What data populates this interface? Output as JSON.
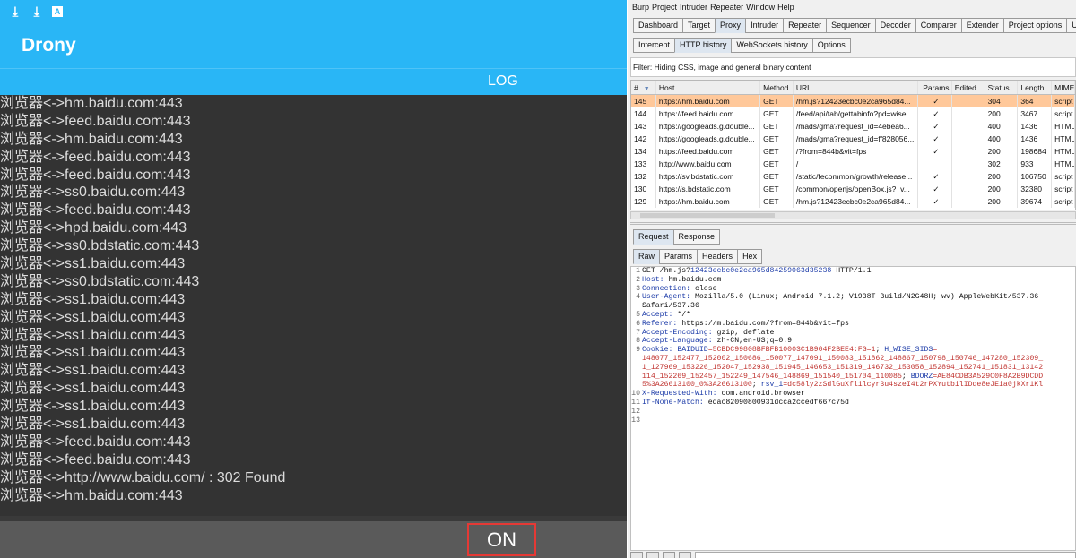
{
  "drony": {
    "app_title": "Drony",
    "tab_label": "LOG",
    "on_button": "ON",
    "statusbar_icons": [
      "download-icon",
      "download-icon",
      "a-box-icon"
    ],
    "log_lines": [
      "浏览器<->hm.baidu.com:443",
      "浏览器<->feed.baidu.com:443",
      "浏览器<->hm.baidu.com:443",
      "浏览器<->feed.baidu.com:443",
      "浏览器<->feed.baidu.com:443",
      "浏览器<->ss0.baidu.com:443",
      "浏览器<->feed.baidu.com:443",
      "浏览器<->hpd.baidu.com:443",
      "浏览器<->ss0.bdstatic.com:443",
      "浏览器<->ss1.baidu.com:443",
      "浏览器<->ss0.bdstatic.com:443",
      "浏览器<->ss1.baidu.com:443",
      "浏览器<->ss1.baidu.com:443",
      "浏览器<->ss1.baidu.com:443",
      "浏览器<->ss1.baidu.com:443",
      "浏览器<->ss1.baidu.com:443",
      "浏览器<->ss1.baidu.com:443",
      "浏览器<->ss1.baidu.com:443",
      "浏览器<->ss1.baidu.com:443",
      "浏览器<->feed.baidu.com:443",
      "浏览器<->feed.baidu.com:443",
      "浏览器<->http://www.baidu.com/ : 302 Found",
      "浏览器<->hm.baidu.com:443"
    ],
    "colors": {
      "accent": "#29b6f6",
      "log_bg": "#333333",
      "on_border": "#e53935"
    }
  },
  "burp": {
    "menu": [
      "Burp",
      "Project",
      "Intruder",
      "Repeater",
      "Window",
      "Help"
    ],
    "main_tabs": [
      "Dashboard",
      "Target",
      "Proxy",
      "Intruder",
      "Repeater",
      "Sequencer",
      "Decoder",
      "Comparer",
      "Extender",
      "Project options",
      "User"
    ],
    "main_tab_active": "Proxy",
    "proxy_tabs": [
      "Intercept",
      "HTTP history",
      "WebSockets history",
      "Options"
    ],
    "proxy_tab_active": "HTTP history",
    "filter_text": "Filter: Hiding CSS, image and general binary content",
    "columns": [
      "#",
      "Host",
      "Method",
      "URL",
      "Params",
      "Edited",
      "Status",
      "Length",
      "MIME"
    ],
    "sort_indicator": "▼",
    "rows": [
      {
        "num": "145",
        "host": "https://hm.baidu.com",
        "method": "GET",
        "url": "/hm.js?12423ecbc0e2ca965d84...",
        "params": "✓",
        "edited": "",
        "status": "304",
        "length": "364",
        "mime": "script",
        "selected": true
      },
      {
        "num": "144",
        "host": "https://feed.baidu.com",
        "method": "GET",
        "url": "/feed/api/tab/gettabinfo?pd=wise...",
        "params": "✓",
        "edited": "",
        "status": "200",
        "length": "3467",
        "mime": "script"
      },
      {
        "num": "143",
        "host": "https://googleads.g.double...",
        "method": "GET",
        "url": "/mads/gma?request_id=4ebea6...",
        "params": "✓",
        "edited": "",
        "status": "400",
        "length": "1436",
        "mime": "HTML"
      },
      {
        "num": "142",
        "host": "https://googleads.g.double...",
        "method": "GET",
        "url": "/mads/gma?request_id=ff828056...",
        "params": "✓",
        "edited": "",
        "status": "400",
        "length": "1436",
        "mime": "HTML"
      },
      {
        "num": "134",
        "host": "https://feed.baidu.com",
        "method": "GET",
        "url": "/?from=844b&vit=fps",
        "params": "✓",
        "edited": "",
        "status": "200",
        "length": "198684",
        "mime": "HTML"
      },
      {
        "num": "133",
        "host": "http://www.baidu.com",
        "method": "GET",
        "url": "/",
        "params": "",
        "edited": "",
        "status": "302",
        "length": "933",
        "mime": "HTML"
      },
      {
        "num": "132",
        "host": "https://sv.bdstatic.com",
        "method": "GET",
        "url": "/static/fecommon/growth/release...",
        "params": "✓",
        "edited": "",
        "status": "200",
        "length": "106750",
        "mime": "script"
      },
      {
        "num": "130",
        "host": "https://s.bdstatic.com",
        "method": "GET",
        "url": "/common/openjs/openBox.js?_v...",
        "params": "✓",
        "edited": "",
        "status": "200",
        "length": "32380",
        "mime": "script"
      },
      {
        "num": "129",
        "host": "https://hm.baidu.com",
        "method": "GET",
        "url": "/hm.js?12423ecbc0e2ca965d84...",
        "params": "✓",
        "edited": "",
        "status": "200",
        "length": "39674",
        "mime": "script"
      }
    ],
    "req_tabs": [
      "Request",
      "Response"
    ],
    "req_tab_active": "Request",
    "raw_tabs": [
      "Raw",
      "Params",
      "Headers",
      "Hex"
    ],
    "raw_tab_active": "Raw",
    "request_lines": [
      {
        "n": "1",
        "parts": [
          [
            "",
            "GET /hm.js?"
          ],
          [
            "blue",
            "12423ecbc0e2ca965d84259063d35238"
          ],
          [
            "",
            " HTTP/1.1"
          ]
        ]
      },
      {
        "n": "2",
        "parts": [
          [
            "key",
            "Host:"
          ],
          [
            "",
            " hm.baidu.com"
          ]
        ]
      },
      {
        "n": "3",
        "parts": [
          [
            "key",
            "Connection:"
          ],
          [
            "",
            " close"
          ]
        ]
      },
      {
        "n": "4",
        "parts": [
          [
            "key",
            "User-Agent:"
          ],
          [
            "",
            " Mozilla/5.0 (Linux; Android 7.1.2; V1938T Build/N2G48H; wv) AppleWebKit/537.36"
          ]
        ]
      },
      {
        "n": "",
        "parts": [
          [
            "",
            "Safari/537.36"
          ]
        ]
      },
      {
        "n": "5",
        "parts": [
          [
            "key",
            "Accept:"
          ],
          [
            "",
            " */*"
          ]
        ]
      },
      {
        "n": "6",
        "parts": [
          [
            "key",
            "Referer:"
          ],
          [
            "",
            " https://m.baidu.com/?from=844b&vit=fps"
          ]
        ]
      },
      {
        "n": "7",
        "parts": [
          [
            "key",
            "Accept-Encoding:"
          ],
          [
            "",
            " gzip, deflate"
          ]
        ]
      },
      {
        "n": "8",
        "parts": [
          [
            "key",
            "Accept-Language:"
          ],
          [
            "",
            " zh-CN,en-US;q=0.9"
          ]
        ]
      },
      {
        "n": "9",
        "parts": [
          [
            "key",
            "Cookie:"
          ],
          [
            "",
            " "
          ],
          [
            "blue",
            "BAIDUID"
          ],
          [
            "red",
            "=5CBDC99808BFBFB10003C1B904F2BEE4:FG=1"
          ],
          [
            "",
            "; "
          ],
          [
            "blue",
            "H_WISE_SIDS"
          ],
          [
            "red",
            "="
          ]
        ]
      },
      {
        "n": "",
        "parts": [
          [
            "red",
            "148077_152477_152002_150686_150077_147091_150083_151862_148867_150798_150746_147280_152309_"
          ]
        ]
      },
      {
        "n": "",
        "parts": [
          [
            "red",
            "1_127969_153226_152047_152938_151945_146653_151319_146732_153058_152894_152741_151831_13142"
          ]
        ]
      },
      {
        "n": "",
        "parts": [
          [
            "red",
            "114_152269_152457_152249_147546_148869_151540_151704_110085"
          ],
          [
            "",
            "; "
          ],
          [
            "blue",
            "BDORZ"
          ],
          [
            "red",
            "=AE84CDB3A529C0F8A2B9DCDD"
          ]
        ]
      },
      {
        "n": "",
        "parts": [
          [
            "red",
            "5%3A26613100_0%3A26613100"
          ],
          [
            "",
            "; "
          ],
          [
            "blue",
            "rsv_i"
          ],
          [
            "red",
            "=dc58ly2zSdlGuXflilcyr3u4szeI4t2rPXYutbilIDqe8eJEia0jkXr1Kl"
          ]
        ]
      },
      {
        "n": "10",
        "parts": [
          [
            "key",
            "X-Requested-With:"
          ],
          [
            "",
            " com.android.browser"
          ]
        ]
      },
      {
        "n": "11",
        "parts": [
          [
            "key",
            "If-None-Match:"
          ],
          [
            "",
            " edac82090800931dcca2ccedf667c75d"
          ]
        ]
      },
      {
        "n": "12",
        "parts": []
      },
      {
        "n": "13",
        "parts": []
      }
    ],
    "colors": {
      "selected_row": "#ffc89a",
      "header_key": "#1c3ba8",
      "cookie_value": "#c0332f"
    }
  }
}
